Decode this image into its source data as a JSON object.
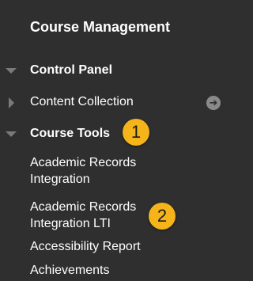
{
  "header": {
    "title": "Course Management"
  },
  "sections": {
    "control_panel": {
      "label": "Control Panel"
    },
    "content_collection": {
      "label": "Content Collection"
    },
    "course_tools": {
      "label": "Course Tools"
    }
  },
  "badges": {
    "one": "1",
    "two": "2"
  },
  "course_tools_items": [
    {
      "label": "Academic Records Integration"
    },
    {
      "label": "Academic Records Integration LTI"
    },
    {
      "label": "Accessibility Report"
    },
    {
      "label": "Achievements"
    }
  ],
  "colors": {
    "background": "#2f2f2f",
    "badge": "#f4b41a",
    "arrow": "#7a7a7a"
  },
  "icons": {
    "expanded": "triangle-down-icon",
    "collapsed": "triangle-right-icon",
    "go": "arrow-circle-right-icon"
  }
}
